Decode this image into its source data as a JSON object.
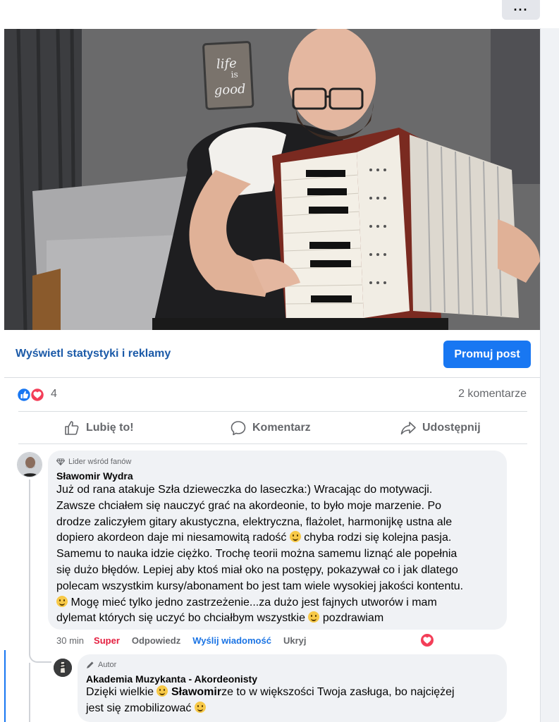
{
  "header": {
    "more_label": "···"
  },
  "video": {
    "mute_icon": "speaker-muted-icon",
    "sign_line1": "life",
    "sign_line2": "good"
  },
  "post_stats": {
    "stats_link": "Wyświetl statystyki i reklamy",
    "promote_label": "Promuj post"
  },
  "reactions": {
    "count": "4",
    "comments": "2 komentarze",
    "icons": [
      "like-icon",
      "love-icon"
    ],
    "colors": {
      "like": "#1877f2",
      "love": "#f33e58"
    }
  },
  "actions": {
    "like": "Lubię to!",
    "comment": "Komentarz",
    "share": "Udostępnij"
  },
  "comment1": {
    "badge": "Lider wśród fanów",
    "author": "Sławomir Wydra",
    "lines": [
      "Już od rana atakuje Szła dzieweczka do laseczka:) Wracając do motywacji.",
      "Zawsze chciałem się nauczyć grać na akordeonie, to było moje marzenie. Po",
      "drodze zaliczyłem gitary akustyczna, elektryczna, flażolet, harmonijkę ustna ale",
      "dopiero akordeon daje mi niesamowitą radość",
      " chyba rodzi się kolejna pasja.",
      "Samemu to nauka idzie ciężko. Trochę teorii można samemu liznąć ale popełnia",
      "się dużo błędów. Lepiej aby ktoś miał oko na postępy, pokazywał co i jak dlatego",
      "polecam wszystkim kursy/abonament bo jest tam wiele wysokiej jakości kontentu.",
      " Mogę mieć tylko jedno zastrzeżenie...za dużo jest fajnych utworów i mam",
      "dylemat których się uczyć bo chciałbym wszystkie",
      " pozdrawiam"
    ],
    "time": "30 min",
    "reaction_label": "Super",
    "reply": "Odpowiedz",
    "send_message": "Wyślij wiadomość",
    "hide": "Ukryj"
  },
  "comment2": {
    "badge": "Autor",
    "author": "Akademia Muzykanta - Akordeonisty",
    "text_a": "Dzięki wielkie",
    "mention": "Sławomir",
    "text_b": "ze to w większości Twoja zasługa, bo najciężej",
    "text_c": "jest się zmobilizować"
  }
}
